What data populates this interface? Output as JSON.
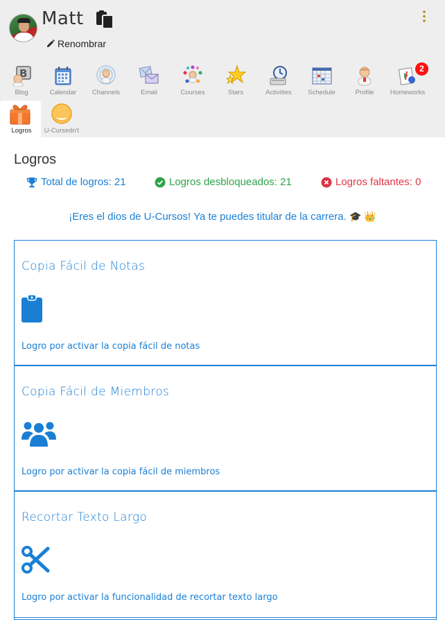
{
  "header": {
    "username": "Matt",
    "rename_label": "Renombrar"
  },
  "nav": {
    "items": [
      {
        "label": "Blog",
        "icon": "blog-icon"
      },
      {
        "label": "Calendar",
        "icon": "calendar-icon"
      },
      {
        "label": "Channels",
        "icon": "channels-icon"
      },
      {
        "label": "Email",
        "icon": "email-icon"
      },
      {
        "label": "Courses",
        "icon": "courses-icon"
      },
      {
        "label": "Stars",
        "icon": "stars-icon"
      },
      {
        "label": "Activities",
        "icon": "activities-icon"
      },
      {
        "label": "Schedule",
        "icon": "schedule-icon"
      },
      {
        "label": "Profile",
        "icon": "profile-icon"
      },
      {
        "label": "Homeworks",
        "icon": "homeworks-icon"
      },
      {
        "label": "Logros",
        "icon": "gift-icon"
      },
      {
        "label": "U-Cursedn't",
        "icon": "smiley-icon"
      }
    ],
    "homeworks_badge": "2",
    "active": "Logros"
  },
  "main": {
    "title": "Logros",
    "stats": {
      "total": "Total de logros: 21",
      "unlocked": "Logros desbloqueados: 21",
      "missing": "Logros faltantes: 0"
    },
    "message": "¡Eres el dios de U-Cursos! Ya te puedes titular de la carrera.",
    "message_emoji": "🎓 👑"
  },
  "cards": [
    {
      "title": "Copia Fácil de Notas",
      "icon": "clipboard-icon",
      "description": "Logro por activar la copia fácil de notas"
    },
    {
      "title": "Copia Fácil de Miembros",
      "icon": "users-icon",
      "description": "Logro por activar la copia fácil de miembros"
    },
    {
      "title": "Recortar Texto Largo",
      "icon": "scissors-icon",
      "description": "Logro por activar la funcionalidad de recortar texto largo"
    }
  ],
  "colors": {
    "accent": "#1a7fd4",
    "success": "#2ea34a",
    "danger": "#dc3545",
    "header_bg": "#eeeeee",
    "badge": "#ff1111"
  }
}
